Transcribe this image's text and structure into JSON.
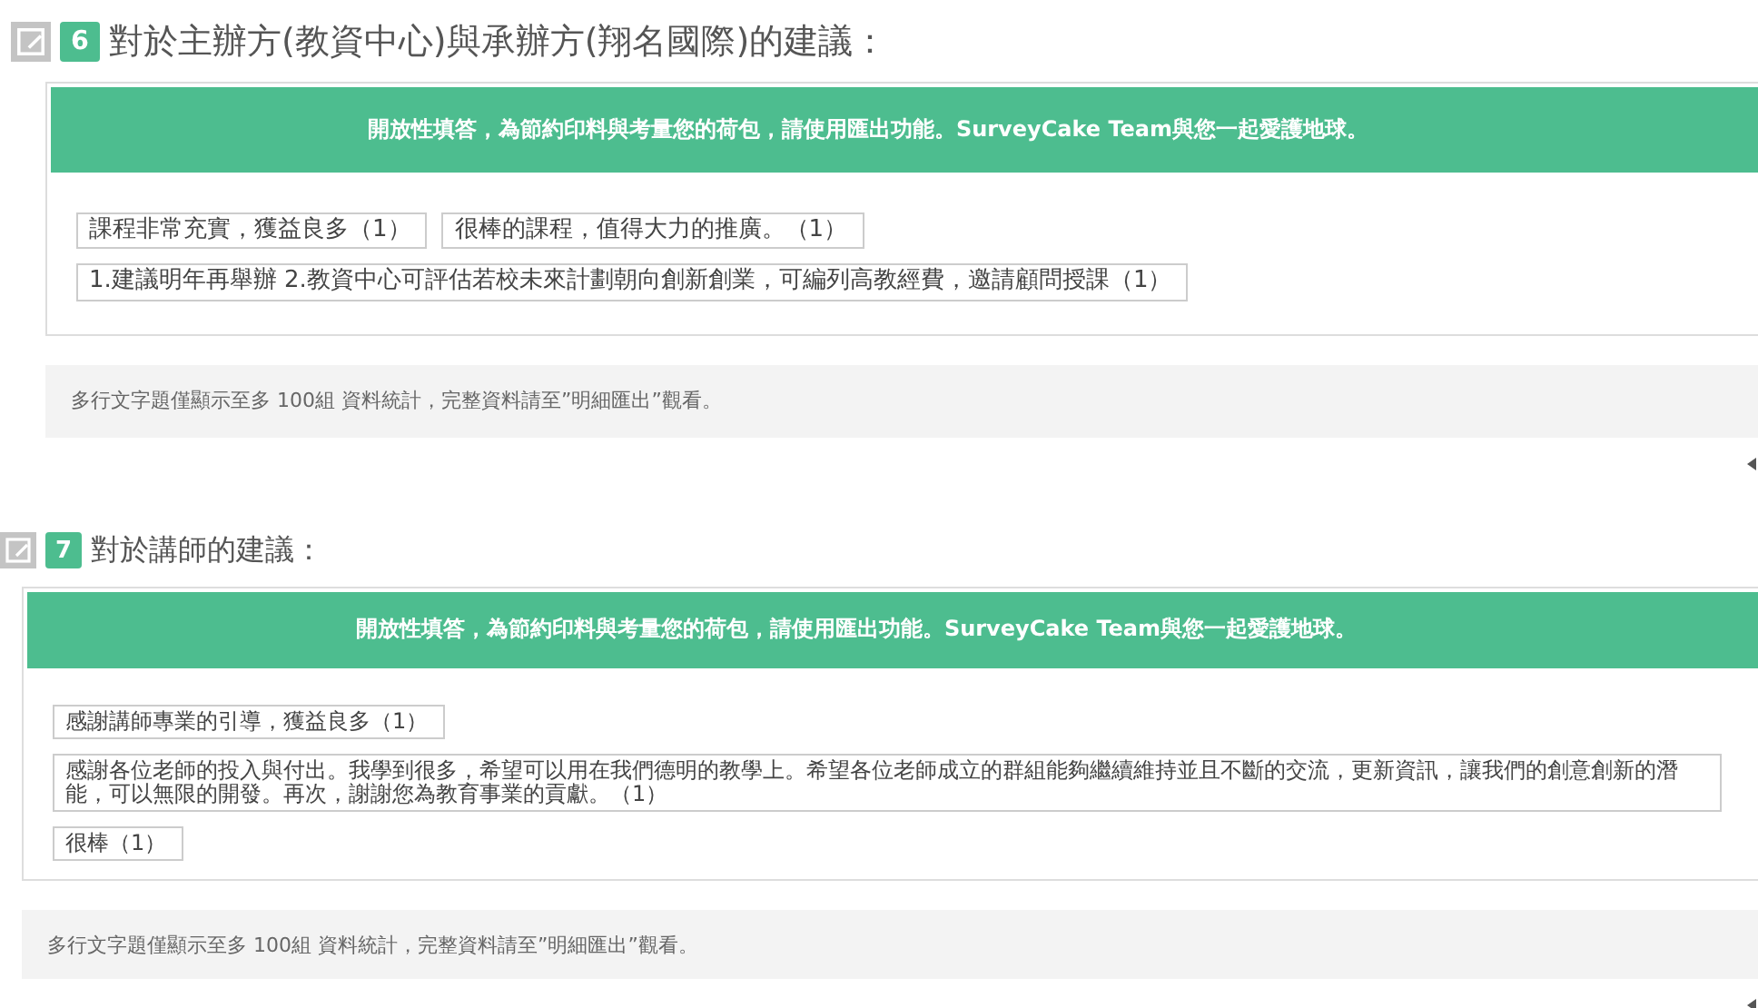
{
  "questions": [
    {
      "number": "6",
      "title": "對於主辦方(教資中心)與承辦方(翔名國際)的建議：",
      "banner": "開放性填答，為節約印料與考量您的荷包，請使用匯出功能。SurveyCake Team與您一起愛護地球。",
      "answers": [
        "課程非常充實，獲益良多（1）",
        "很棒的課程，值得大力的推廣。（1）",
        "1.建議明年再舉辦 2.教資中心可評估若校未來計劃朝向創新創業，可編列高教經費，邀請顧問授課（1）"
      ],
      "note": "多行文字題僅顯示至多 100組 資料統計，完整資料請至”明細匯出”觀看。"
    },
    {
      "number": "7",
      "title": "對於講師的建議：",
      "banner": "開放性填答，為節約印料與考量您的荷包，請使用匯出功能。SurveyCake Team與您一起愛護地球。",
      "answers": [
        "感謝講師專業的引導，獲益良多（1）",
        "感謝各位老師的投入與付出。我學到很多，希望可以用在我們德明的教學上。希望各位老師成立的群組能夠繼續維持並且不斷的交流，更新資訊，讓我們的創意創新的潛能，可以無限的開發。再次，謝謝您為教育事業的貢獻。（1）",
        "很棒（1）"
      ],
      "note": "多行文字題僅顯示至多 100組 資料統計，完整資料請至”明細匯出”觀看。"
    }
  ]
}
